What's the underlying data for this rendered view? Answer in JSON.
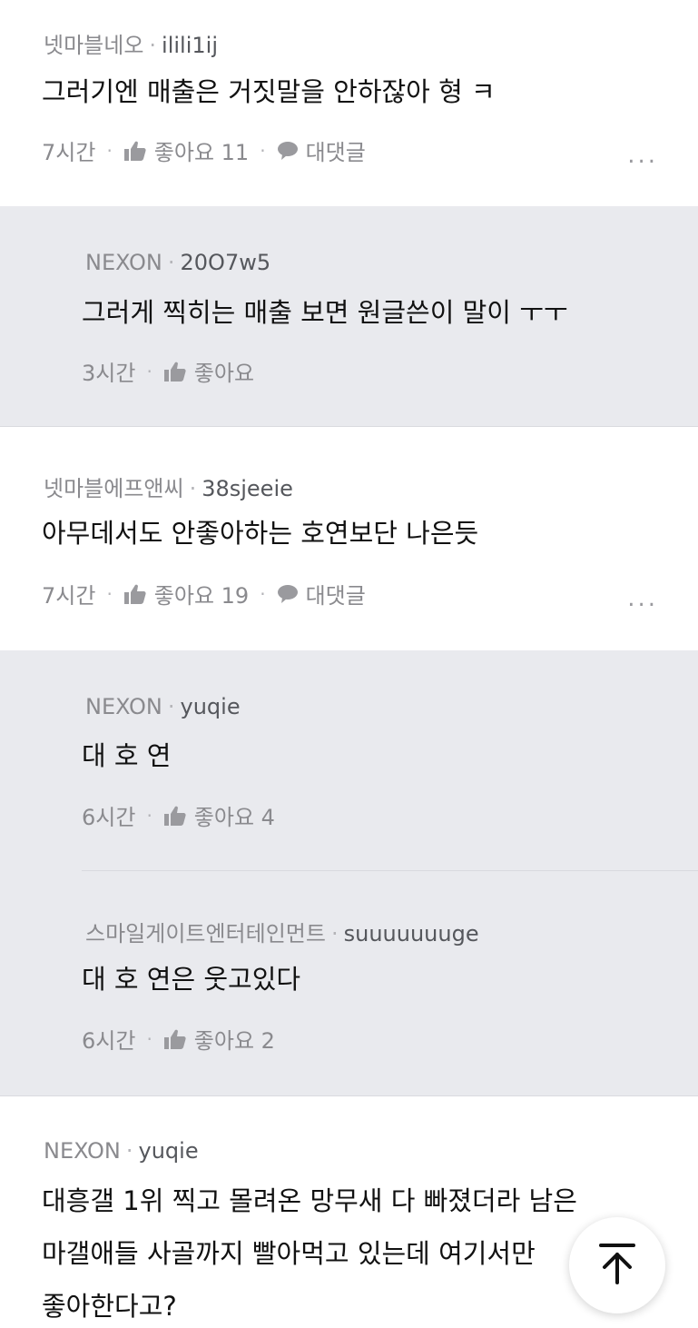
{
  "comments": [
    {
      "company": "넷마블네오",
      "nick": "ilili1ij",
      "text": "그러기엔 매출은 거짓말을 안하잖아 형 ㅋ",
      "time": "7시간",
      "like_label": "좋아요 11",
      "reply_label": "대댓글",
      "more_label": "..."
    },
    {
      "company": "NEXON",
      "nick": "20O7w5",
      "text": "그러게 찍히는 매출 보면 원글쓴이 말이 ㅜㅜ",
      "time": "3시간",
      "like_label": "좋아요"
    },
    {
      "company": "넷마블에프앤씨",
      "nick": "38sjeeie",
      "text": "아무데서도 안좋아하는 호연보단 나은듯",
      "time": "7시간",
      "like_label": "좋아요 19",
      "reply_label": "대댓글",
      "more_label": "..."
    },
    {
      "company": "NEXON",
      "nick": "yuqie",
      "text": "대 호 연",
      "time": "6시간",
      "like_label": "좋아요 4"
    },
    {
      "company": "스마일게이트엔터테인먼트",
      "nick": "suuuuuuuge",
      "text": "대 호 연은 웃고있다",
      "time": "6시간",
      "like_label": "좋아요 2"
    },
    {
      "company": "NEXON",
      "nick": "yuqie",
      "text_lines": [
        "대흥갤 1위 찍고 몰려온 망무새 다 빠졌더라 남은",
        "마갤애들 사골까지 빨아먹고 있는데 여기서만",
        "좋아한다고?"
      ]
    }
  ],
  "separator": "·",
  "icons": {
    "like": "thumbs-up-icon",
    "reply": "speech-bubble-icon",
    "more": "more-dots-icon",
    "scroll_top": "arrow-up-icon"
  },
  "colors": {
    "reply_bg": "#e9eaee",
    "meta_text": "#8a8a8e",
    "body_text": "#111111"
  }
}
